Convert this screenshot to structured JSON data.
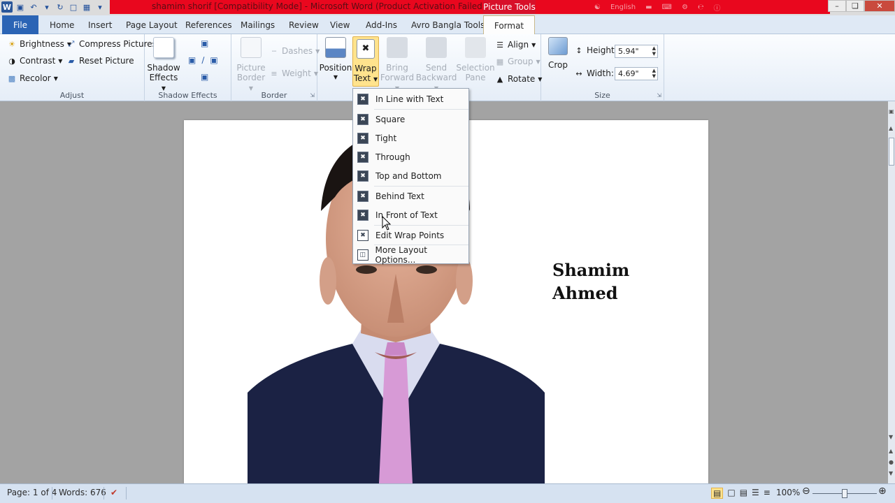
{
  "window": {
    "title": "shamim shorif [Compatibility Mode] - Microsoft Word (Product Activation Failed)",
    "context_tab": "Picture Tools",
    "language": "English"
  },
  "tabs": [
    "File",
    "Home",
    "Insert",
    "Page Layout",
    "References",
    "Mailings",
    "Review",
    "View",
    "Add-Ins",
    "Avro Bangla Tools",
    "Format"
  ],
  "ribbon": {
    "adjust": {
      "label": "Adjust",
      "brightness": "Brightness",
      "contrast": "Contrast",
      "recolor": "Recolor",
      "compress": "Compress Pictures",
      "reset": "Reset Picture"
    },
    "shadow": {
      "label": "Shadow Effects",
      "button_line1": "Shadow",
      "button_line2": "Effects"
    },
    "border": {
      "label": "Border",
      "picture_border_line1": "Picture",
      "picture_border_line2": "Border",
      "dashes": "Dashes",
      "weight": "Weight"
    },
    "arrange": {
      "position": "Position",
      "wrap_line1": "Wrap",
      "wrap_line2": "Text",
      "bring_line1": "Bring",
      "bring_line2": "Forward",
      "send_line1": "Send",
      "send_line2": "Backward",
      "selection_line1": "Selection",
      "selection_line2": "Pane",
      "align": "Align",
      "group": "Group",
      "rotate": "Rotate"
    },
    "size": {
      "label": "Size",
      "crop": "Crop",
      "height_label": "Height:",
      "height_value": "5.94\"",
      "width_label": "Width:",
      "width_value": "4.69\""
    }
  },
  "wrap_menu": [
    "In Line with Text",
    "Square",
    "Tight",
    "Through",
    "Top and Bottom",
    "Behind Text",
    "In Front of Text",
    "Edit Wrap Points",
    "More Layout Options..."
  ],
  "document": {
    "name_line1": "Shamim",
    "name_line2": "Ahmed"
  },
  "status": {
    "page": "Page: 1 of 4",
    "words": "Words: 676",
    "zoom": "100%"
  },
  "colors": {
    "titlebar_red": "#e9071e",
    "file_tab": "#2b64b5",
    "wrap_active": "#ffe38d"
  }
}
